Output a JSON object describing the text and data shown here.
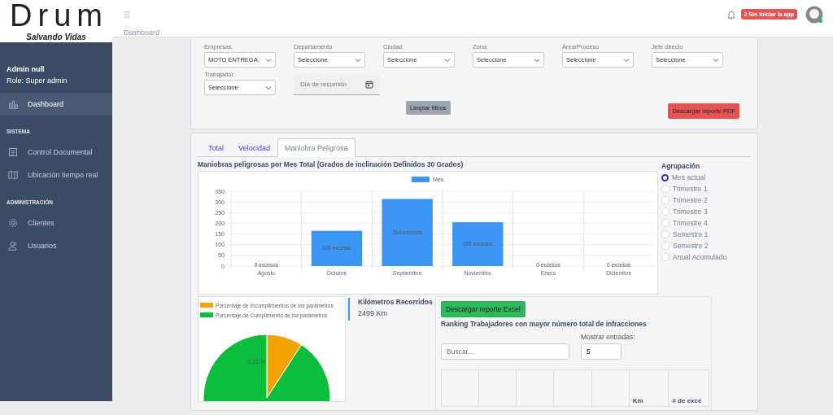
{
  "logo": {
    "title": "Drum",
    "tagline": "Salvando Vidas"
  },
  "header": {
    "badge": "2 Sin iniciar la app"
  },
  "breadcrumb": "Dashboard",
  "user": {
    "name": "Admin null",
    "role": "Role: Super admin"
  },
  "sidebar": {
    "sections": [
      {
        "items": [
          {
            "label": "Dashboard",
            "selected": true
          }
        ]
      },
      {
        "title": "SISTEMA",
        "items": [
          {
            "label": "Control Documental",
            "selected": false
          },
          {
            "label": "Ubicación tiempo real",
            "selected": false
          }
        ]
      },
      {
        "title": "ADMINISTRACIÓN",
        "items": [
          {
            "label": "Clientes",
            "selected": false
          },
          {
            "label": "Usuarios",
            "selected": false
          }
        ]
      }
    ]
  },
  "filters": [
    {
      "kind": "select",
      "label": "Empresas",
      "value": "MOTO ENTREGA"
    },
    {
      "kind": "select",
      "label": "Departamento",
      "value": "Seleccione"
    },
    {
      "kind": "select",
      "label": "Ciudad",
      "value": "Seleccione"
    },
    {
      "kind": "select",
      "label": "Zona",
      "value": "Seleccione"
    },
    {
      "kind": "select",
      "label": "Área/Proceso",
      "value": "Seleccione"
    },
    {
      "kind": "select",
      "label": "Jefe directo",
      "value": "Seleccione"
    },
    {
      "kind": "select",
      "label": "Trabajador",
      "value": "Seleccione"
    },
    {
      "kind": "date",
      "placeholder": "Dia de recorrido"
    }
  ],
  "clear_button": "Limpiar filtros",
  "pdf_button": "Descargar reporte PDF",
  "tabs": [
    {
      "label": "Total",
      "selected": false
    },
    {
      "label": "Velocidad",
      "selected": false
    },
    {
      "label": "Maniobra Peligrosa",
      "selected": true
    }
  ],
  "bar_chart": {
    "chart_data": {
      "type": "bar",
      "title": "Maniobras peligrosas por Mes Total (Grados de inclinación Definidos 30 Grados)",
      "categories": [
        "Agosto",
        "Octubre",
        "Septiembre",
        "Noviembre",
        "Enero",
        "Diciembre"
      ],
      "series": [
        {
          "name": "Mes",
          "color": "#3d95f5",
          "values": [
            0,
            165,
            314,
            205,
            0,
            0
          ]
        }
      ],
      "ylim": [
        0,
        350
      ],
      "grid": true,
      "yticks": [
        0,
        50,
        100,
        150,
        200,
        250,
        300,
        350
      ],
      "value_labels": [
        "0 excesos",
        "165 excesos",
        "314 excesos",
        "205 excesos",
        "0 excesos",
        "0 excesos"
      ]
    }
  },
  "grouping": {
    "title": "Agrupación",
    "options": [
      {
        "label": "Mes actual",
        "selected": true
      },
      {
        "label": "Trimestre 1",
        "selected": false
      },
      {
        "label": "Trimestre 2",
        "selected": false
      },
      {
        "label": "Trimestre 3",
        "selected": false
      },
      {
        "label": "Trimestre 4",
        "selected": false
      },
      {
        "label": "Semestre 1",
        "selected": false
      },
      {
        "label": "Semestre 2",
        "selected": false
      },
      {
        "label": "Anual Acumulado",
        "selected": false
      }
    ]
  },
  "pie_chart": {
    "chart_data": {
      "type": "pie",
      "categories": [
        "Porcentaje de Incumplimientos de los parámetros",
        "Porcentaje de Cumplimiento de los parámetros"
      ],
      "series": [
        {
          "values": [
            9.21,
            90.79
          ]
        }
      ],
      "colors": [
        "#f5a300",
        "#0bbd3c"
      ],
      "value_labels": [
        "9.21 %",
        null
      ]
    }
  },
  "km": {
    "label": "Kilómetros Recorridos",
    "value": "2499 Km"
  },
  "ranking": {
    "excel_button": "Descargar reporte Excel",
    "title": "Ranking Trabajadores con mayor número total de infracciones",
    "search_placeholder": "Buscar...",
    "entries_label": "Mostrar entradas:",
    "entries_value": "5",
    "columns": [
      {},
      {},
      {},
      {},
      {},
      {
        "label": "Km"
      },
      {
        "label": "# de exce"
      }
    ]
  }
}
